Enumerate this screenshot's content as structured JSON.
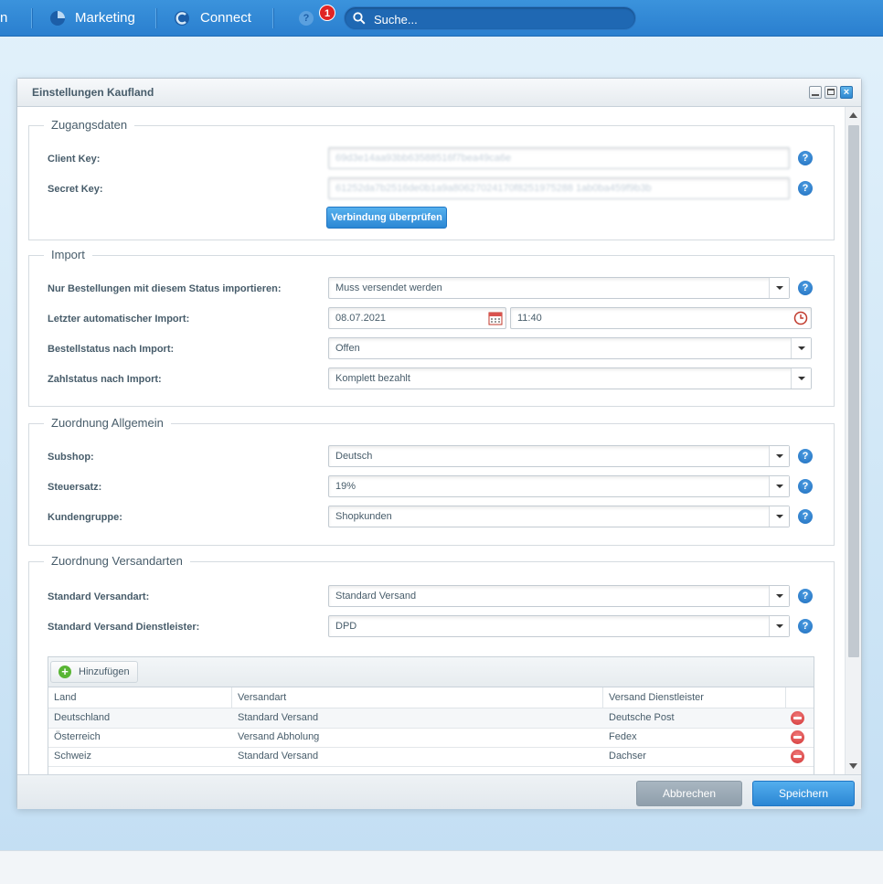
{
  "topnav": {
    "partial_item": "n",
    "marketing": "Marketing",
    "connect": "Connect",
    "notification_count": "1",
    "search_placeholder": "Suche..."
  },
  "window": {
    "title": "Einstellungen Kaufland",
    "close_glyph": "×"
  },
  "zugang": {
    "legend": "Zugangsdaten",
    "client_key_label": "Client Key:",
    "client_key_value": "69d3e14aa93bb63588516f7bea49ca6e",
    "secret_key_label": "Secret Key:",
    "secret_key_value": "61252da7b2516de0b1a9a80627024170f8251975288 1ab0ba459f9b3b",
    "verify_button": "Verbindung überprüfen"
  },
  "import": {
    "legend": "Import",
    "status_label": "Nur Bestellungen mit diesem Status importieren:",
    "status_value": "Muss versendet werden",
    "last_import_label": "Letzter automatischer Import:",
    "last_import_date": "08.07.2021",
    "last_import_time": "11:40",
    "order_status_label": "Bestellstatus nach Import:",
    "order_status_value": "Offen",
    "payment_status_label": "Zahlstatus nach Import:",
    "payment_status_value": "Komplett bezahlt"
  },
  "allgemein": {
    "legend": "Zuordnung Allgemein",
    "subshop_label": "Subshop:",
    "subshop_value": "Deutsch",
    "tax_label": "Steuersatz:",
    "tax_value": "19%",
    "customer_group_label": "Kundengruppe:",
    "customer_group_value": "Shopkunden"
  },
  "versand": {
    "legend": "Zuordnung Versandarten",
    "default_shipping_label": "Standard Versandart:",
    "default_shipping_value": "Standard Versand",
    "default_carrier_label": "Standard Versand Dienstleister:",
    "default_carrier_value": "DPD",
    "add_button": "Hinzufügen",
    "columns": [
      "Land",
      "Versandart",
      "Versand Dienstleister"
    ],
    "rows": [
      {
        "land": "Deutschland",
        "versandart": "Standard Versand",
        "dienstleister": "Deutsche Post"
      },
      {
        "land": "Österreich",
        "versandart": "Versand Abholung",
        "dienstleister": "Fedex"
      },
      {
        "land": "Schweiz",
        "versandart": "Standard Versand",
        "dienstleister": "Dachser"
      }
    ]
  },
  "footer": {
    "cancel": "Abbrechen",
    "save": "Speichern"
  },
  "help_glyph": "?",
  "add_glyph": "+",
  "colors": {
    "topbar": "#2a7fcf",
    "primary": "#2b87d4",
    "delete": "#d23535",
    "add": "#58b534"
  }
}
